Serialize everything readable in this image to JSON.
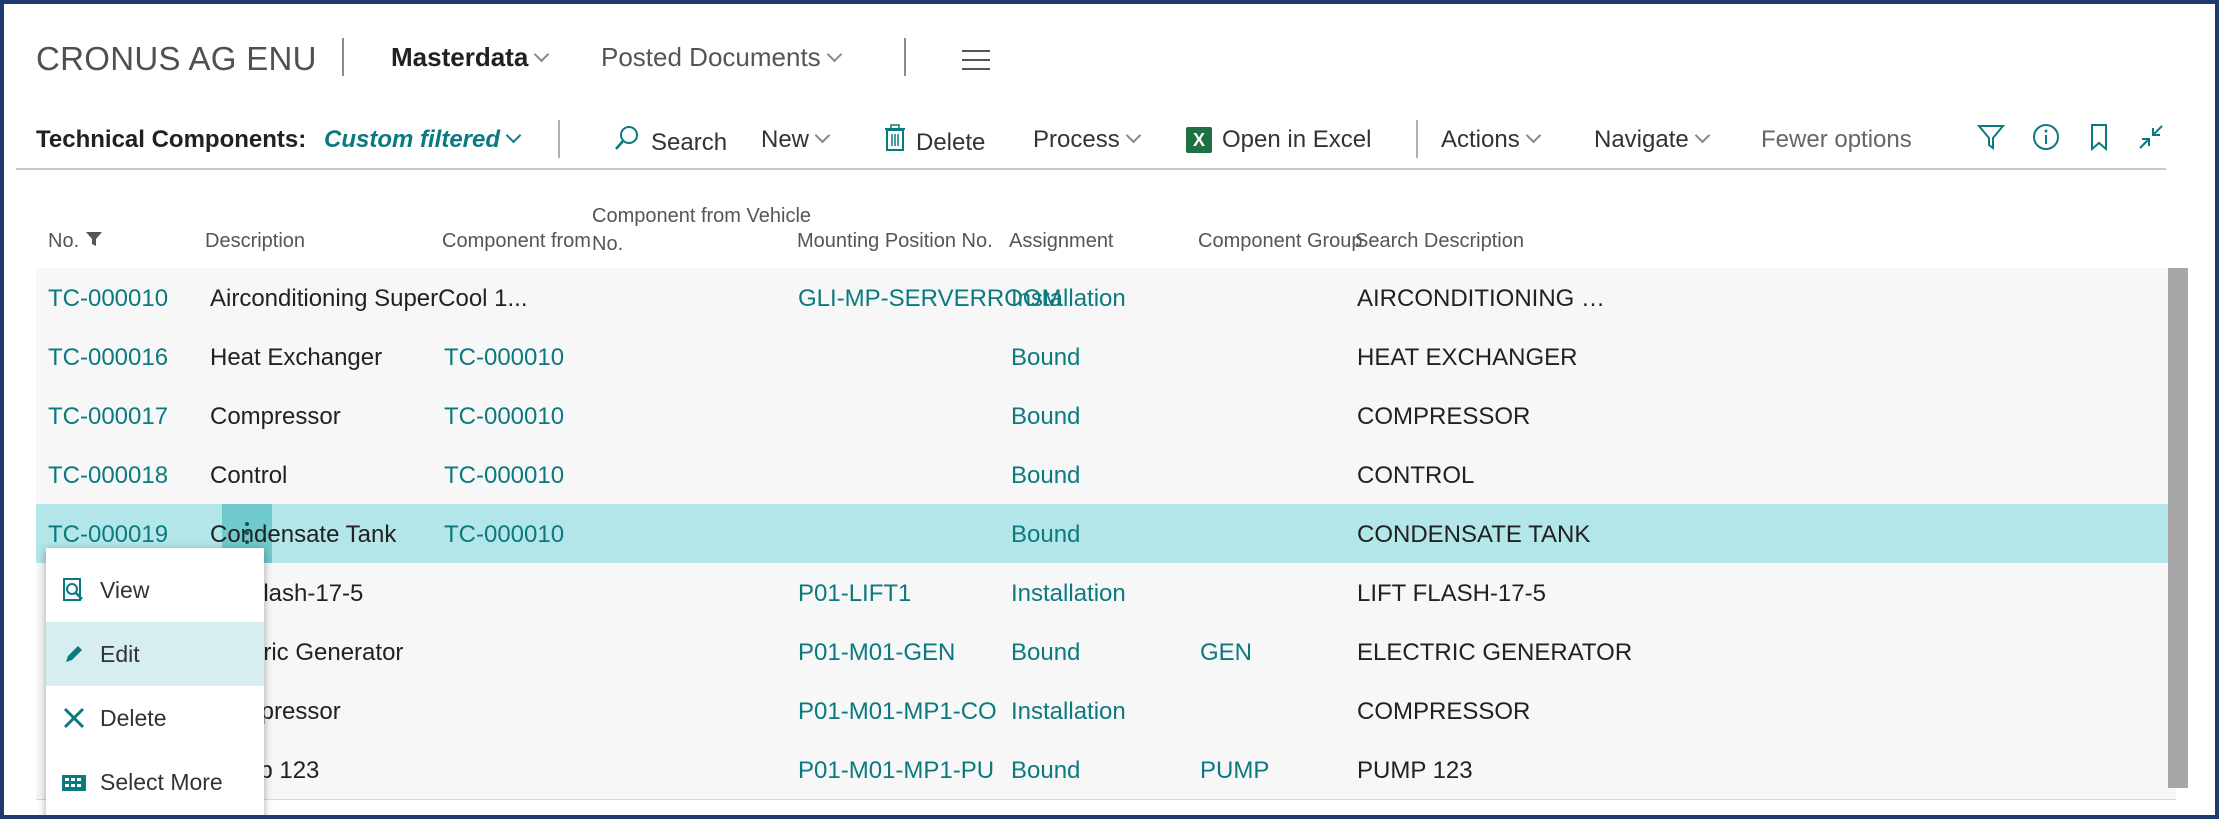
{
  "company": "CRONUS AG ENU",
  "nav": {
    "masterdata": "Masterdata",
    "posted_documents": "Posted Documents"
  },
  "actionbar": {
    "title": "Technical Components:",
    "filter_label": "Custom filtered",
    "search": "Search",
    "new": "New",
    "delete": "Delete",
    "process": "Process",
    "open_in_excel": "Open in Excel",
    "actions": "Actions",
    "navigate": "Navigate",
    "fewer_options": "Fewer options",
    "icons": [
      "filter-icon",
      "info-icon",
      "bookmark-icon",
      "collapse-icon"
    ]
  },
  "columns": {
    "no": "No.",
    "description": "Description",
    "component_from": "Component from",
    "component_from_vehicle_1": "Component from Vehicle",
    "component_from_vehicle_2": "No.",
    "mounting_position": "Mounting Position No.",
    "assignment": "Assignment",
    "component_group": "Component Group",
    "search_description": "Search Description"
  },
  "rows": [
    {
      "no": "TC-000010",
      "description": "Airconditioning SuperCool 1...",
      "component_from": "",
      "mounting_position": "GLI-MP-SERVERROOM",
      "assignment": "Installation",
      "component_group": "",
      "search_description": "AIRCONDITIONING SU..."
    },
    {
      "no": "TC-000016",
      "description": "Heat Exchanger",
      "component_from": "TC-000010",
      "mounting_position": "",
      "assignment": "Bound",
      "component_group": "",
      "search_description": "HEAT EXCHANGER"
    },
    {
      "no": "TC-000017",
      "description": "Compressor",
      "component_from": "TC-000010",
      "mounting_position": "",
      "assignment": "Bound",
      "component_group": "",
      "search_description": "COMPRESSOR"
    },
    {
      "no": "TC-000018",
      "description": "Control",
      "component_from": "TC-000010",
      "mounting_position": "",
      "assignment": "Bound",
      "component_group": "",
      "search_description": "CONTROL"
    },
    {
      "no": "TC-000019",
      "description": "Condensate Tank",
      "component_from": "TC-000010",
      "mounting_position": "",
      "assignment": "Bound",
      "component_group": "",
      "search_description": "CONDENSATE TANK"
    },
    {
      "no": "",
      "description": "Lift Flash-17-5",
      "component_from": "",
      "mounting_position": "P01-LIFT1",
      "assignment": "Installation",
      "component_group": "",
      "search_description": "LIFT FLASH-17-5"
    },
    {
      "no": "",
      "description": "Electric Generator",
      "component_from": "",
      "mounting_position": "P01-M01-GEN",
      "assignment": "Bound",
      "component_group": "GEN",
      "search_description": "ELECTRIC GENERATOR"
    },
    {
      "no": "",
      "description": "Compressor",
      "component_from": "",
      "mounting_position": "P01-M01-MP1-CO",
      "assignment": "Installation",
      "component_group": "",
      "search_description": "COMPRESSOR"
    },
    {
      "no": "",
      "description": "Pump 123",
      "component_from": "",
      "mounting_position": "P01-M01-MP1-PU",
      "assignment": "Bound",
      "component_group": "PUMP",
      "search_description": "PUMP 123"
    }
  ],
  "context_menu": {
    "view": "View",
    "edit": "Edit",
    "delete": "Delete",
    "select_more": "Select More"
  },
  "colors": {
    "accent": "#0b7a80",
    "selected_row": "#b3e6e8",
    "frame": "#1d3b6e"
  }
}
